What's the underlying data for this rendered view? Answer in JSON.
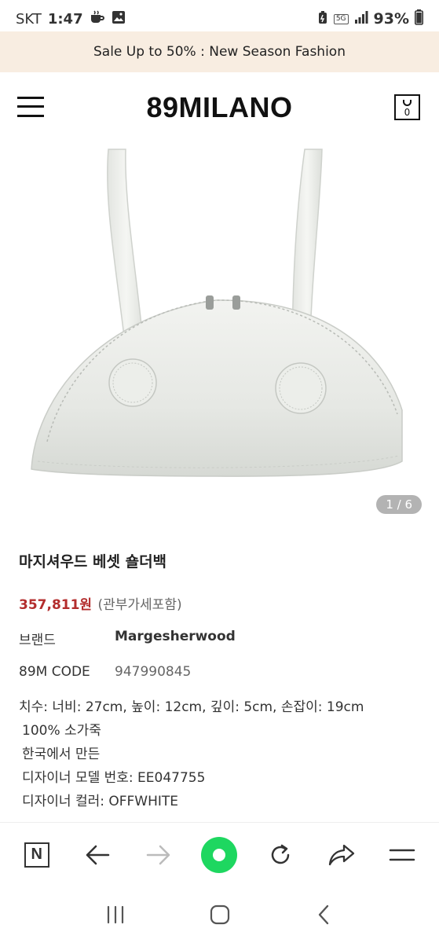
{
  "status": {
    "carrier": "SKT",
    "time": "1:47",
    "network": "5G",
    "battery": "93%"
  },
  "promo": {
    "text": "Sale Up to 50% : New Season Fashion"
  },
  "header": {
    "logo": "89MILANO",
    "cart_count": "0"
  },
  "gallery": {
    "counter": "1 / 6"
  },
  "product": {
    "title": "마지셔우드 베셋 숄더백",
    "price": "357,811원",
    "price_note": "(관부가세포함)",
    "brand_label": "브랜드",
    "brand_value": "Margesherwood",
    "code_label": "89M CODE",
    "code_value": "947990845",
    "description": [
      "치수: 너비: 27cm, 높이: 12cm, 깊이: 5cm, 손잡이: 19cm",
      "100% 소가죽",
      "한국에서 만든",
      "디자이너 모델 번호: EE047755",
      "디자이너 컬러: OFFWHITE"
    ]
  },
  "colors": {
    "promo_bg": "#f8ede1",
    "price": "#b32d2d",
    "accent_green": "#1ed760"
  },
  "icons": {
    "menu": "hamburger-icon",
    "cart": "shopping-bag-icon",
    "toolbar": [
      "naver-n-icon",
      "back-arrow-icon",
      "forward-arrow-icon",
      "green-home-icon",
      "refresh-icon",
      "share-icon",
      "menu-lines-icon"
    ],
    "nav": [
      "recent-apps-icon",
      "home-icon",
      "back-icon"
    ]
  }
}
